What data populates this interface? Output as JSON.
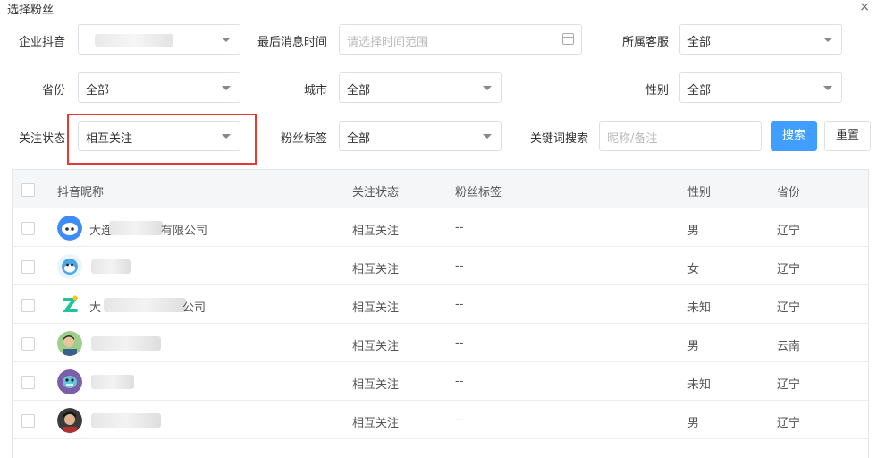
{
  "dialog": {
    "title": "选择粉丝",
    "close_glyph": "×"
  },
  "filters": {
    "enterprise": {
      "label": "企业抖音",
      "value": ""
    },
    "last_msg_time": {
      "label": "最后消息时间",
      "placeholder": "请选择时间范围"
    },
    "service": {
      "label": "所属客服",
      "value": "全部"
    },
    "province": {
      "label": "省份",
      "value": "全部"
    },
    "city": {
      "label": "城市",
      "value": "全部"
    },
    "gender": {
      "label": "性别",
      "value": "全部"
    },
    "follow_status": {
      "label": "关注状态",
      "value": "相互关注"
    },
    "fan_tag": {
      "label": "粉丝标签",
      "value": "全部"
    },
    "keyword": {
      "label": "关键词搜索",
      "placeholder": "昵称/备注"
    }
  },
  "buttons": {
    "search": "搜索",
    "reset": "重置"
  },
  "table": {
    "columns": [
      "抖音昵称",
      "关注状态",
      "粉丝标签",
      "性别",
      "省份"
    ],
    "rows": [
      {
        "name_prefix": "大连",
        "name_suffix": "有限公司",
        "status": "相互关注",
        "tag": "--",
        "gender": "男",
        "province": "辽宁",
        "avatar": "blue-bot-icon"
      },
      {
        "name_prefix": "",
        "name_suffix": "",
        "status": "相互关注",
        "tag": "--",
        "gender": "女",
        "province": "辽宁",
        "avatar": "monkey-icon"
      },
      {
        "name_prefix": "大",
        "name_suffix": "公司",
        "status": "相互关注",
        "tag": "--",
        "gender": "未知",
        "province": "辽宁",
        "avatar": "green-z-icon"
      },
      {
        "name_prefix": "",
        "name_suffix": "",
        "status": "相互关注",
        "tag": "--",
        "gender": "男",
        "province": "云南",
        "avatar": "person-photo"
      },
      {
        "name_prefix": "",
        "name_suffix": "",
        "status": "相互关注",
        "tag": "--",
        "gender": "未知",
        "province": "辽宁",
        "avatar": "purple-monster-icon"
      },
      {
        "name_prefix": "",
        "name_suffix": "",
        "status": "相互关注",
        "tag": "--",
        "gender": "男",
        "province": "辽宁",
        "avatar": "person-photo-dark"
      }
    ]
  },
  "colors": {
    "primary": "#409eff",
    "highlight": "#e53935"
  }
}
